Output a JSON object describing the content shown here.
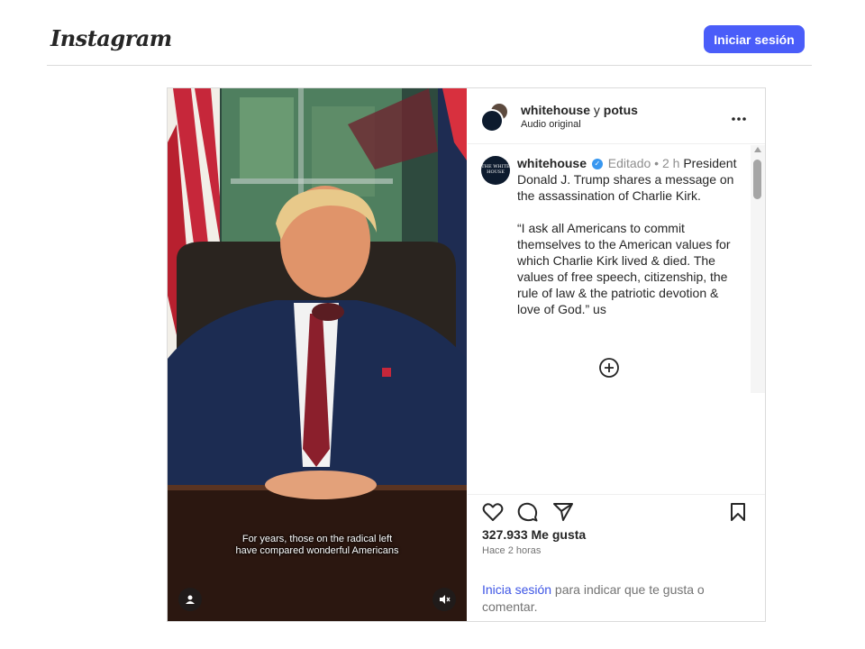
{
  "header": {
    "logo": "Instagram",
    "login_button": "Iniciar sesión"
  },
  "post": {
    "video": {
      "subtitle_line1": "For years, those on the radical left",
      "subtitle_line2": "have compared wonderful Americans"
    },
    "authors": {
      "primary": "whitehouse",
      "connector": "y",
      "secondary": "potus",
      "audio": "Audio original"
    },
    "caption": {
      "username": "whitehouse",
      "edited": "Editado",
      "time_ago": "2 h",
      "line1": "President Donald J. Trump shares a message on the assassination of Charlie Kirk.",
      "line2": "“I ask all Americans to commit themselves to the American values for which Charlie Kirk lived & died. The values of free speech, citizenship, the rule of law & the patriotic devotion & love of God.” us",
      "avatar_text": "THE WHITE HOUSE"
    },
    "likes": "327.933 Me gusta",
    "timestamp": "Hace 2 horas",
    "login_prompt": {
      "link": "Inicia sesión",
      "text": " para indicar que te gusta o comentar."
    }
  },
  "icons": {
    "more": "more-options-icon",
    "like": "heart-icon",
    "comment": "comment-icon",
    "share": "share-icon",
    "save": "bookmark-icon",
    "load_more": "plus-circle-icon",
    "user_tag": "user-tag-icon",
    "mute": "mute-icon"
  },
  "colors": {
    "accent": "#4a5df9",
    "link": "#3d55e5",
    "verified": "#3897f0"
  }
}
